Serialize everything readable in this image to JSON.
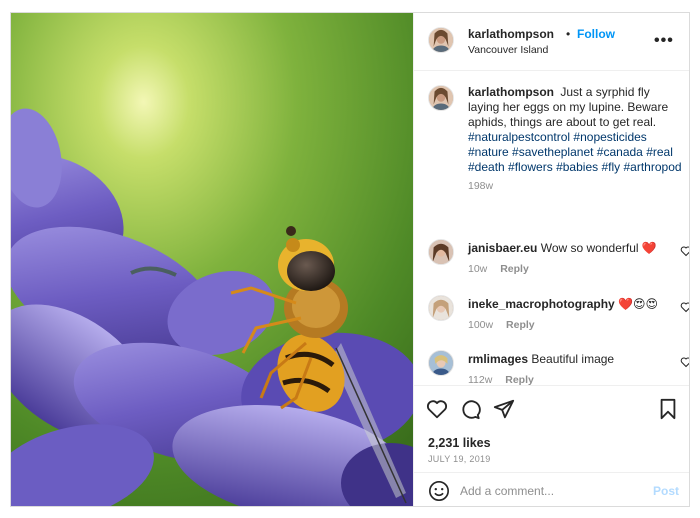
{
  "post": {
    "author": "karlathompson",
    "follow_label": "Follow",
    "dot": "•",
    "location": "Vancouver Island",
    "more_label": "•••",
    "photo_alt": "Syrphid fly on lupine"
  },
  "caption": {
    "author": "karlathompson",
    "text": "Just a syrphid fly laying her eggs on my lupine. Beware aphids, things are about to get real.",
    "hashtags": [
      "#naturalpestcontrol",
      "#nopesticides",
      "#nature",
      "#savetheplanet",
      "#canada",
      "#real",
      "#death",
      "#flowers",
      "#babies",
      "#fly",
      "#arthropod"
    ],
    "age": "198w"
  },
  "comments": [
    {
      "author": "janisbaer.eu",
      "text": "Wow so wonderful ❤️",
      "age": "10w",
      "reply_label": "Reply"
    },
    {
      "author": "ineke_macrophotography",
      "text": "❤️😍😍",
      "age": "100w",
      "reply_label": "Reply"
    },
    {
      "author": "rmlimages",
      "text": "Beautiful image",
      "age": "112w",
      "reply_label": "Reply"
    }
  ],
  "stats": {
    "likes": "2,231 likes",
    "date": "JULY 19, 2019"
  },
  "compose": {
    "placeholder": "Add a comment...",
    "post_label": "Post"
  },
  "icons": {
    "like": "heart-icon",
    "comment": "comment-bubble-icon",
    "share": "paper-plane-icon",
    "save": "bookmark-icon",
    "emoji": "smiley-icon",
    "more": "more-options-icon"
  },
  "colors": {
    "follow": "#0095f6",
    "hashtag": "#00376b",
    "post_disabled": "#b3dbff",
    "muted": "#8e8e8e"
  }
}
